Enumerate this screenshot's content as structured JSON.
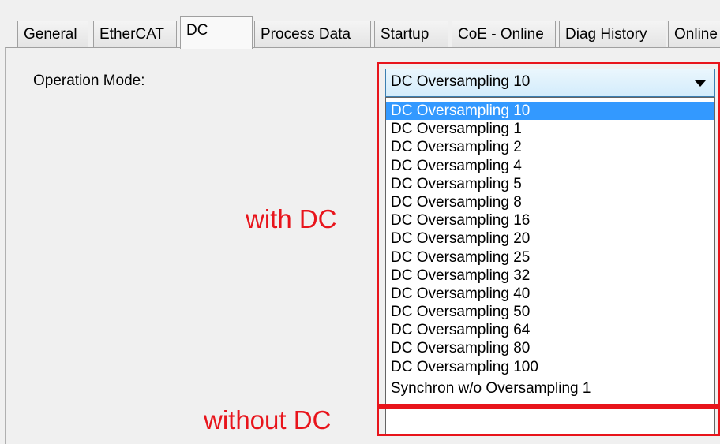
{
  "tabs": [
    {
      "label": "General"
    },
    {
      "label": "EtherCAT"
    },
    {
      "label": "DC"
    },
    {
      "label": "Process Data"
    },
    {
      "label": "Startup"
    },
    {
      "label": "CoE - Online"
    },
    {
      "label": "Diag History"
    },
    {
      "label": "Online"
    }
  ],
  "active_tab": "DC",
  "operation_mode": {
    "label": "Operation Mode:",
    "selected": "DC Oversampling 10",
    "options": [
      "DC Oversampling 10",
      "DC Oversampling 1",
      "DC Oversampling 2",
      "DC Oversampling 4",
      "DC Oversampling 5",
      "DC Oversampling 8",
      "DC Oversampling 16",
      "DC Oversampling 20",
      "DC Oversampling 25",
      "DC Oversampling 32",
      "DC Oversampling 40",
      "DC Oversampling 50",
      "DC Oversampling 64",
      "DC Oversampling 80",
      "DC Oversampling 100",
      "Synchron w/o  Oversampling 1"
    ]
  },
  "annotations": {
    "with_dc": "with DC",
    "without_dc": "without DC",
    "color": "#e8141b"
  }
}
